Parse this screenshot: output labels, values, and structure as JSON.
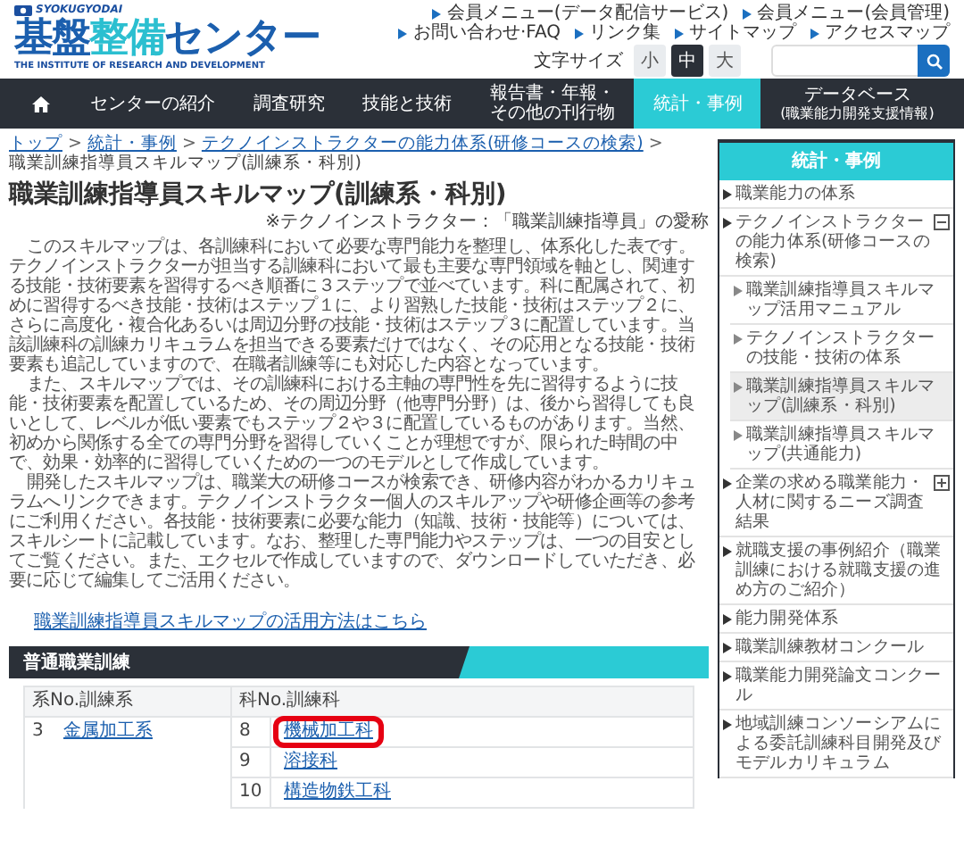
{
  "header": {
    "logo_small": "SYOKUGYODAI",
    "logo_parts": [
      "基盤",
      "整備",
      "センター"
    ],
    "logo_subtitle": "THE INSTITUTE OF RESEARCH AND DEVELOPMENT",
    "links": [
      "会員メニュー(データ配信サービス)",
      "会員メニュー(会員管理)",
      "お問い合わせ·FAQ",
      "リンク集",
      "サイトマップ",
      "アクセスマップ"
    ],
    "font_size": {
      "label": "文字サイズ",
      "options": [
        {
          "label": "小",
          "selected": false
        },
        {
          "label": "中",
          "selected": true
        },
        {
          "label": "大",
          "selected": false
        }
      ]
    }
  },
  "nav": [
    {
      "kind": "home"
    },
    {
      "kind": "link",
      "label": "センターの紹介",
      "selected": false
    },
    {
      "kind": "link",
      "label": "調査研究",
      "selected": false
    },
    {
      "kind": "link",
      "label": "技能と技術",
      "selected": false
    },
    {
      "kind": "link",
      "lines": [
        "報告書・年報・",
        "その他の刊行物"
      ],
      "selected": false
    },
    {
      "kind": "link",
      "label": "統計・事例",
      "selected": true
    },
    {
      "kind": "link",
      "label": "データベース",
      "note": "(職業能力開発支援情報)",
      "selected": false
    }
  ],
  "breadcrumb": [
    {
      "kind": "link",
      "label": "トップ"
    },
    {
      "kind": "separator",
      "label": ">"
    },
    {
      "kind": "link",
      "label": "統計・事例"
    },
    {
      "kind": "separator",
      "label": ">"
    },
    {
      "kind": "link",
      "label": "テクノインストラクターの能力体系(研修コースの検索)"
    },
    {
      "kind": "separator",
      "label": ">"
    },
    {
      "kind": "current",
      "label": "職業訓練指導員スキルマップ(訓練系・科別)"
    }
  ],
  "title": "職業訓練指導員スキルマップ(訓練系・科別)",
  "note": "※テクノインストラクター：「職業訓練指導員」の愛称",
  "paragraphs": [
    "このスキルマップは、各訓練科において必要な専門能力を整理し、体系化した表です。テクノインストラクターが担当する訓練科において最も主要な専門領域を軸とし、関連する技能・技術要素を習得するべき順番に３ステップで並べています。科に配属されて、初めに習得するべき技能・技術はステップ１に、より習熟した技能・技術はステップ２に、さらに高度化・複合化あるいは周辺分野の技能・技術はステップ３に配置しています。当該訓練科の訓練カリキュラムを担当できる要素だけではなく、その応用となる技能・技術要素も追記していますので、在職者訓練等にも対応した内容となっています。",
    "また、スキルマップでは、その訓練科における主軸の専門性を先に習得するように技能・技術要素を配置しているため、その周辺分野（他専門分野）は、後から習得しても良いとして、レベルが低い要素でもステップ２や３に配置しているものがあります。当然、初めから関係する全ての専門分野を習得していくことが理想ですが、限られた時間の中で、効果・効率的に習得していくための一つのモデルとして作成しています。",
    "開発したスキルマップは、職業大の研修コースが検索でき、研修内容がわかるカリキュラムへリンクできます。テクノインストラクター個人のスキルアップや研修企画等の参考にご利用ください。各技能・技術要素に必要な能力（知識、技術・技能等）については、スキルシートに記載しています。なお、整理した専門能力やステップは、一つの目安としてご覧ください。また、エクセルで作成していますので、ダウンロードしていただき、必要に応じて編集してご活用ください。"
  ],
  "usage_link": "職業訓練指導員スキルマップの活用方法はこちら",
  "section": {
    "title": "普通職業訓練"
  },
  "table": {
    "columns": [
      "系No.訓練系",
      "科No.訓練科"
    ],
    "groups": [
      {
        "no": "3",
        "name": "金属加工系",
        "subjects": [
          {
            "no": "8",
            "name": "機械加工科",
            "highlighted": true
          },
          {
            "no": "9",
            "name": "溶接科",
            "highlighted": false
          },
          {
            "no": "10",
            "name": "構造物鉄工科",
            "highlighted": false
          }
        ]
      }
    ]
  },
  "sidebar": {
    "title": "統計・事例",
    "items": [
      {
        "label": "職業能力の体系",
        "selected": false
      },
      {
        "label": "テクノインストラクターの能力体系(研修コースの検索)",
        "selected": false,
        "expanded": true,
        "children": [
          {
            "label": "職業訓練指導員スキルマップ活用マニュアル",
            "selected": false
          },
          {
            "label": "テクノインストラクターの技能・技術の体系",
            "selected": false
          },
          {
            "label": "職業訓練指導員スキルマップ(訓練系・科別)",
            "selected": true
          },
          {
            "label": "職業訓練指導員スキルマップ(共通能力)",
            "selected": false
          }
        ]
      },
      {
        "label": "企業の求める職業能力・人材に関するニーズ調査結果",
        "selected": false,
        "expanded": false
      },
      {
        "label": "就職支援の事例紹介（職業訓練における就職支援の進め方のご紹介）",
        "selected": false
      },
      {
        "label": "能力開発体系",
        "selected": false
      },
      {
        "label": "職業訓練教材コンクール",
        "selected": false
      },
      {
        "label": "職業能力開発論文コンクール",
        "selected": false
      },
      {
        "label": "地域訓練コンソーシアムによる委託訓練科目開発及びモデルカリキュラム",
        "selected": false
      }
    ]
  }
}
